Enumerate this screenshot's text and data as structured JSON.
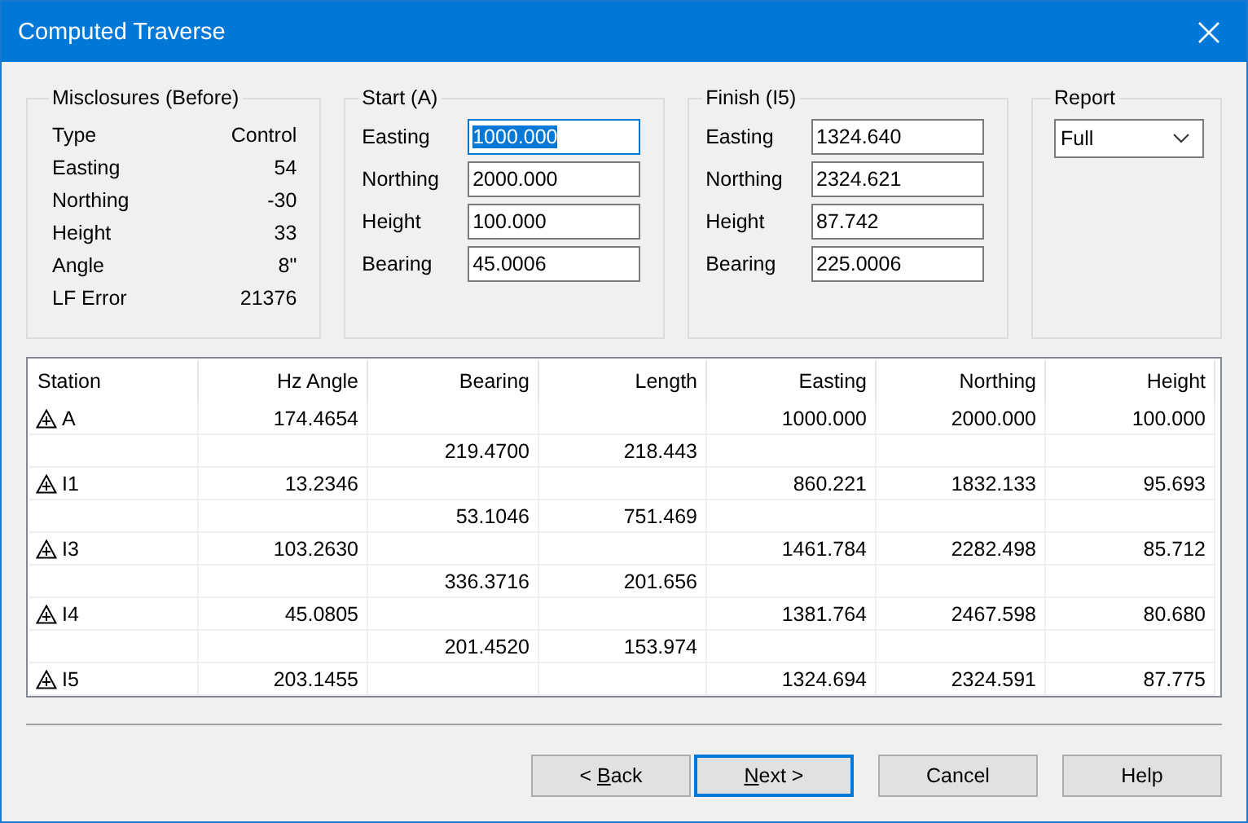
{
  "window": {
    "title": "Computed Traverse"
  },
  "misclosures": {
    "title": "Misclosures (Before)",
    "rows": [
      {
        "label": "Type",
        "value": "Control"
      },
      {
        "label": "Easting",
        "value": "54"
      },
      {
        "label": "Northing",
        "value": "-30"
      },
      {
        "label": "Height",
        "value": "33"
      },
      {
        "label": "Angle",
        "value": "8\""
      },
      {
        "label": "LF Error",
        "value": "21376"
      }
    ]
  },
  "start": {
    "title": "Start (A)",
    "fields": [
      {
        "label": "Easting",
        "value": "1000.000",
        "focused": true
      },
      {
        "label": "Northing",
        "value": "2000.000",
        "focused": false
      },
      {
        "label": "Height",
        "value": "100.000",
        "focused": false
      },
      {
        "label": "Bearing",
        "value": "45.0006",
        "focused": false
      }
    ]
  },
  "finish": {
    "title": "Finish (I5)",
    "fields": [
      {
        "label": "Easting",
        "value": "1324.640",
        "focused": false
      },
      {
        "label": "Northing",
        "value": "2324.621",
        "focused": false
      },
      {
        "label": "Height",
        "value": "87.742",
        "focused": false
      },
      {
        "label": "Bearing",
        "value": "225.0006",
        "focused": false
      }
    ]
  },
  "report": {
    "title": "Report",
    "value": "Full"
  },
  "table": {
    "columns": [
      "Station",
      "Hz Angle",
      "Bearing",
      "Length",
      "Easting",
      "Northing",
      "Height"
    ],
    "rows": [
      {
        "kind": "station",
        "cells": [
          "A",
          "174.4654",
          "",
          "",
          "1000.000",
          "2000.000",
          "100.000"
        ]
      },
      {
        "kind": "leg",
        "cells": [
          "",
          "",
          "219.4700",
          "218.443",
          "",
          "",
          ""
        ]
      },
      {
        "kind": "station",
        "cells": [
          "I1",
          "13.2346",
          "",
          "",
          "860.221",
          "1832.133",
          "95.693"
        ]
      },
      {
        "kind": "leg",
        "cells": [
          "",
          "",
          "53.1046",
          "751.469",
          "",
          "",
          ""
        ]
      },
      {
        "kind": "station",
        "cells": [
          "I3",
          "103.2630",
          "",
          "",
          "1461.784",
          "2282.498",
          "85.712"
        ]
      },
      {
        "kind": "leg",
        "cells": [
          "",
          "",
          "336.3716",
          "201.656",
          "",
          "",
          ""
        ]
      },
      {
        "kind": "station",
        "cells": [
          "I4",
          "45.0805",
          "",
          "",
          "1381.764",
          "2467.598",
          "80.680"
        ]
      },
      {
        "kind": "leg",
        "cells": [
          "",
          "",
          "201.4520",
          "153.974",
          "",
          "",
          ""
        ]
      },
      {
        "kind": "station",
        "cells": [
          "I5",
          "203.1455",
          "",
          "",
          "1324.694",
          "2324.591",
          "87.775"
        ]
      }
    ]
  },
  "buttons": [
    {
      "prefix": "< ",
      "key": "B",
      "rest": "ack",
      "default": false
    },
    {
      "key": "N",
      "rest": "ext >",
      "default": true
    },
    {
      "label": "Cancel",
      "default": false
    },
    {
      "label": "Help",
      "default": false
    }
  ]
}
